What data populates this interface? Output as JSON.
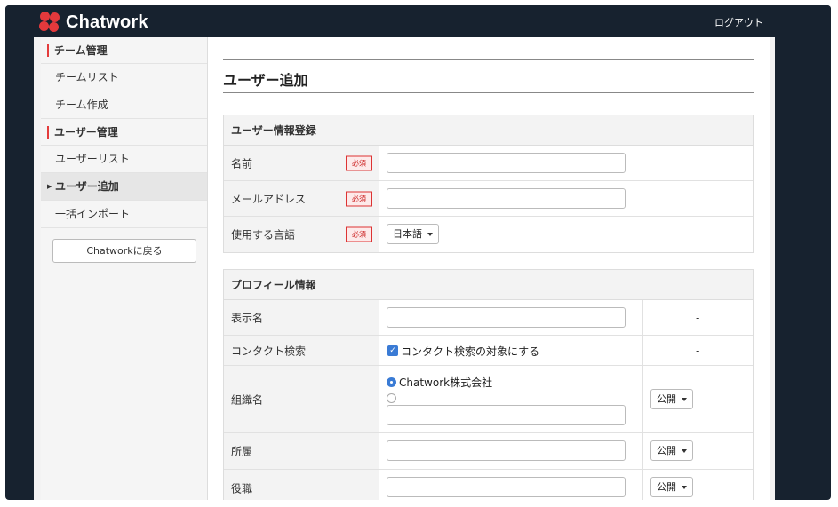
{
  "app": {
    "logo_text": "Chatwork",
    "logout_label": "ログアウト"
  },
  "colors": {
    "topbar": "#17222f",
    "accent_red": "#e43c3c",
    "required_red": "#cc2222",
    "check_blue": "#3a7bd5",
    "logo_red": "#e4393c"
  },
  "sidebar": {
    "items": [
      {
        "label": "チーム管理",
        "type": "header"
      },
      {
        "label": "チームリスト",
        "type": "link"
      },
      {
        "label": "チーム作成",
        "type": "link"
      },
      {
        "label": "ユーザー管理",
        "type": "header"
      },
      {
        "label": "ユーザーリスト",
        "type": "link"
      },
      {
        "label": "ユーザー追加",
        "type": "active"
      },
      {
        "label": "一括インポート",
        "type": "link"
      }
    ],
    "back_button": "Chatworkに戻る"
  },
  "main": {
    "page_title": "ユーザー追加",
    "user_section": {
      "title": "ユーザー情報登録",
      "required_badge": "必須",
      "rows": [
        {
          "label": "名前",
          "value": ""
        },
        {
          "label": "メールアドレス",
          "value": ""
        },
        {
          "label": "使用する言語",
          "select_value": "日本語"
        }
      ]
    },
    "profile_section": {
      "title": "プロフィール情報",
      "display_name_label": "表示名",
      "display_name_value": "",
      "display_name_dash": "-",
      "contact_search_label": "コンタクト検索",
      "contact_search_checkbox": "コンタクト検索の対象にする",
      "contact_search_dash": "-",
      "org_label": "組織名",
      "org_option_1": "Chatwork株式会社",
      "org_custom_value": "",
      "org_visibility": "公開",
      "dept_label": "所属",
      "dept_value": "",
      "dept_visibility": "公開",
      "role_label": "役職",
      "role_value": "",
      "role_visibility": "公開"
    }
  }
}
